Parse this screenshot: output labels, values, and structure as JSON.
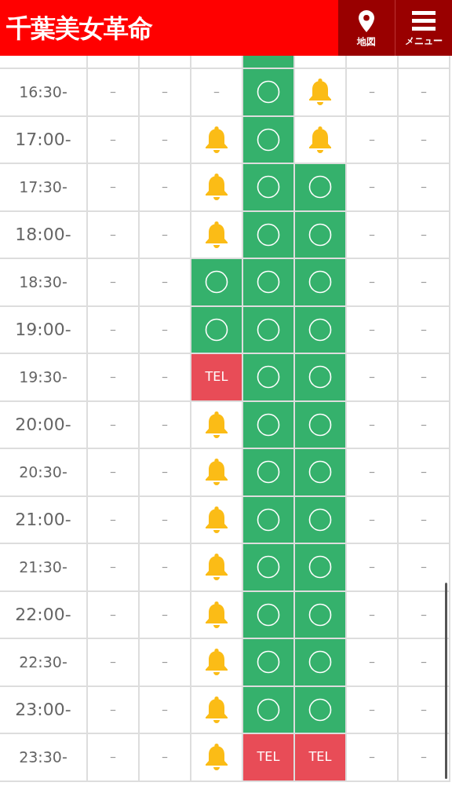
{
  "header": {
    "logo": "千葉美女革命",
    "buttons": [
      {
        "kind": "pin",
        "label": "地図"
      },
      {
        "kind": "menu",
        "label": "メニュー"
      }
    ]
  },
  "partial_row": {
    "cells": [
      {
        "kind": "empty"
      },
      {
        "kind": "empty"
      },
      {
        "kind": "empty"
      },
      {
        "kind": "empty"
      },
      {
        "kind": "green"
      },
      {
        "kind": "empty"
      },
      {
        "kind": "empty"
      },
      {
        "kind": "empty"
      }
    ]
  },
  "rows": [
    {
      "time": "16:30-",
      "kind": "half",
      "cells": [
        {
          "kind": "dash",
          "text": "–"
        },
        {
          "kind": "dash",
          "text": "–"
        },
        {
          "kind": "dash",
          "text": "–"
        },
        {
          "kind": "circle"
        },
        {
          "kind": "bell"
        },
        {
          "kind": "dash",
          "text": "–"
        },
        {
          "kind": "dash",
          "text": "–"
        }
      ]
    },
    {
      "time": "17:00-",
      "kind": "hour",
      "cells": [
        {
          "kind": "dash",
          "text": "–"
        },
        {
          "kind": "dash",
          "text": "–"
        },
        {
          "kind": "bell"
        },
        {
          "kind": "circle"
        },
        {
          "kind": "bell"
        },
        {
          "kind": "dash",
          "text": "–"
        },
        {
          "kind": "dash",
          "text": "–"
        }
      ]
    },
    {
      "time": "17:30-",
      "kind": "half",
      "cells": [
        {
          "kind": "dash",
          "text": "–"
        },
        {
          "kind": "dash",
          "text": "–"
        },
        {
          "kind": "bell"
        },
        {
          "kind": "circle"
        },
        {
          "kind": "circle"
        },
        {
          "kind": "dash",
          "text": "–"
        },
        {
          "kind": "dash",
          "text": "–"
        }
      ]
    },
    {
      "time": "18:00-",
      "kind": "hour",
      "cells": [
        {
          "kind": "dash",
          "text": "–"
        },
        {
          "kind": "dash",
          "text": "–"
        },
        {
          "kind": "bell"
        },
        {
          "kind": "circle"
        },
        {
          "kind": "circle"
        },
        {
          "kind": "dash",
          "text": "–"
        },
        {
          "kind": "dash",
          "text": "–"
        }
      ]
    },
    {
      "time": "18:30-",
      "kind": "half",
      "cells": [
        {
          "kind": "dash",
          "text": "–"
        },
        {
          "kind": "dash",
          "text": "–"
        },
        {
          "kind": "circle"
        },
        {
          "kind": "circle"
        },
        {
          "kind": "circle"
        },
        {
          "kind": "dash",
          "text": "–"
        },
        {
          "kind": "dash",
          "text": "–"
        }
      ]
    },
    {
      "time": "19:00-",
      "kind": "hour",
      "cells": [
        {
          "kind": "dash",
          "text": "–"
        },
        {
          "kind": "dash",
          "text": "–"
        },
        {
          "kind": "circle"
        },
        {
          "kind": "circle"
        },
        {
          "kind": "circle"
        },
        {
          "kind": "dash",
          "text": "–"
        },
        {
          "kind": "dash",
          "text": "–"
        }
      ]
    },
    {
      "time": "19:30-",
      "kind": "half",
      "cells": [
        {
          "kind": "dash",
          "text": "–"
        },
        {
          "kind": "dash",
          "text": "–"
        },
        {
          "kind": "tel",
          "text": "TEL"
        },
        {
          "kind": "circle"
        },
        {
          "kind": "circle"
        },
        {
          "kind": "dash",
          "text": "–"
        },
        {
          "kind": "dash",
          "text": "–"
        }
      ]
    },
    {
      "time": "20:00-",
      "kind": "hour",
      "cells": [
        {
          "kind": "dash",
          "text": "–"
        },
        {
          "kind": "dash",
          "text": "–"
        },
        {
          "kind": "bell"
        },
        {
          "kind": "circle"
        },
        {
          "kind": "circle"
        },
        {
          "kind": "dash",
          "text": "–"
        },
        {
          "kind": "dash",
          "text": "–"
        }
      ]
    },
    {
      "time": "20:30-",
      "kind": "half",
      "cells": [
        {
          "kind": "dash",
          "text": "–"
        },
        {
          "kind": "dash",
          "text": "–"
        },
        {
          "kind": "bell"
        },
        {
          "kind": "circle"
        },
        {
          "kind": "circle"
        },
        {
          "kind": "dash",
          "text": "–"
        },
        {
          "kind": "dash",
          "text": "–"
        }
      ]
    },
    {
      "time": "21:00-",
      "kind": "hour",
      "cells": [
        {
          "kind": "dash",
          "text": "–"
        },
        {
          "kind": "dash",
          "text": "–"
        },
        {
          "kind": "bell"
        },
        {
          "kind": "circle"
        },
        {
          "kind": "circle"
        },
        {
          "kind": "dash",
          "text": "–"
        },
        {
          "kind": "dash",
          "text": "–"
        }
      ]
    },
    {
      "time": "21:30-",
      "kind": "half",
      "cells": [
        {
          "kind": "dash",
          "text": "–"
        },
        {
          "kind": "dash",
          "text": "–"
        },
        {
          "kind": "bell"
        },
        {
          "kind": "circle"
        },
        {
          "kind": "circle"
        },
        {
          "kind": "dash",
          "text": "–"
        },
        {
          "kind": "dash",
          "text": "–"
        }
      ]
    },
    {
      "time": "22:00-",
      "kind": "hour",
      "cells": [
        {
          "kind": "dash",
          "text": "–"
        },
        {
          "kind": "dash",
          "text": "–"
        },
        {
          "kind": "bell"
        },
        {
          "kind": "circle"
        },
        {
          "kind": "circle"
        },
        {
          "kind": "dash",
          "text": "–"
        },
        {
          "kind": "dash",
          "text": "–"
        }
      ]
    },
    {
      "time": "22:30-",
      "kind": "half",
      "cells": [
        {
          "kind": "dash",
          "text": "–"
        },
        {
          "kind": "dash",
          "text": "–"
        },
        {
          "kind": "bell"
        },
        {
          "kind": "circle"
        },
        {
          "kind": "circle"
        },
        {
          "kind": "dash",
          "text": "–"
        },
        {
          "kind": "dash",
          "text": "–"
        }
      ]
    },
    {
      "time": "23:00-",
      "kind": "hour",
      "cells": [
        {
          "kind": "dash",
          "text": "–"
        },
        {
          "kind": "dash",
          "text": "–"
        },
        {
          "kind": "bell"
        },
        {
          "kind": "circle"
        },
        {
          "kind": "circle"
        },
        {
          "kind": "dash",
          "text": "–"
        },
        {
          "kind": "dash",
          "text": "–"
        }
      ]
    },
    {
      "time": "23:30-",
      "kind": "half",
      "cells": [
        {
          "kind": "dash",
          "text": "–"
        },
        {
          "kind": "dash",
          "text": "–"
        },
        {
          "kind": "bell"
        },
        {
          "kind": "tel",
          "text": "TEL"
        },
        {
          "kind": "tel",
          "text": "TEL"
        },
        {
          "kind": "dash",
          "text": "–"
        },
        {
          "kind": "dash",
          "text": "–"
        }
      ]
    }
  ]
}
